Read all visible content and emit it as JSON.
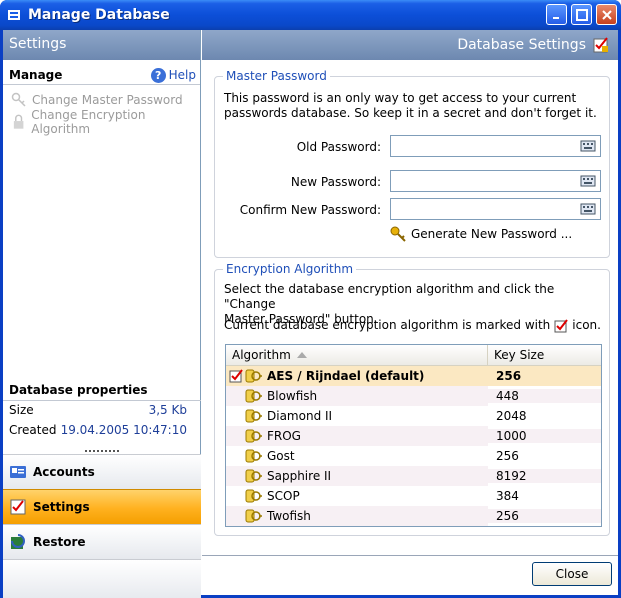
{
  "window": {
    "title": "Manage Database"
  },
  "left": {
    "header": "Settings",
    "manage_title": "Manage",
    "help_label": "Help",
    "tasks": [
      {
        "label": "Change Master Password",
        "icon": "key-icon"
      },
      {
        "label": "Change Encryption Algorithm",
        "icon": "lock-icon"
      }
    ],
    "props_title": "Database properties",
    "props": [
      {
        "label": "Size",
        "value": "3,5 Kb"
      },
      {
        "label": "Created",
        "value": "19.04.2005 10:47:10"
      }
    ],
    "nav": [
      {
        "label": "Accounts",
        "icon": "accounts-icon",
        "active": false
      },
      {
        "label": "Settings",
        "icon": "settings-icon",
        "active": true
      },
      {
        "label": "Restore",
        "icon": "restore-icon",
        "active": false
      }
    ]
  },
  "right": {
    "header": "Database Settings",
    "master": {
      "title": "Master Password",
      "desc_line1": "This password is an only way to get access to your current",
      "desc_line2": "passwords database. So keep it in a secret and don't forget it.",
      "old_label": "Old Password:",
      "new_label": "New Password:",
      "confirm_label": "Confirm New Password:",
      "old_value": "",
      "new_value": "",
      "confirm_value": "",
      "generate_label": "Generate New Password ..."
    },
    "encryption": {
      "title": "Encryption Algorithm",
      "desc_line1": "Select the database encryption algorithm and click the \"Change",
      "desc_line2": "Master Password\" button.",
      "current_prefix": "Current database encryption algorithm is marked with",
      "current_suffix": "icon.",
      "col_algorithm": "Algorithm",
      "col_keysize": "Key Size",
      "rows": [
        {
          "name": "AES / Rijndael (default)",
          "key": "256",
          "selected": true
        },
        {
          "name": "Blowfish",
          "key": "448"
        },
        {
          "name": "Diamond II",
          "key": "2048"
        },
        {
          "name": "FROG",
          "key": "1000"
        },
        {
          "name": "Gost",
          "key": "256"
        },
        {
          "name": "Sapphire II",
          "key": "8192"
        },
        {
          "name": "SCOP",
          "key": "384"
        },
        {
          "name": "Twofish",
          "key": "256"
        }
      ]
    },
    "close_label": "Close"
  }
}
